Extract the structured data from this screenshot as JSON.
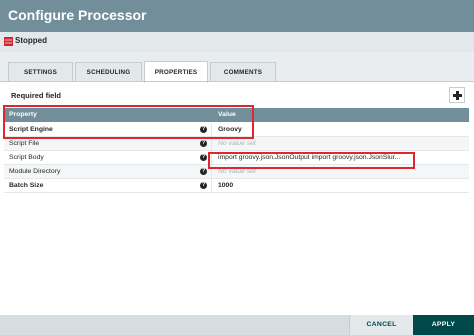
{
  "dialog": {
    "title": "Configure Processor"
  },
  "status": {
    "text": "Stopped",
    "icon": "stopped-icon",
    "color": "#d1252f"
  },
  "tabs": [
    {
      "label": "SETTINGS",
      "active": false
    },
    {
      "label": "SCHEDULING",
      "active": false
    },
    {
      "label": "PROPERTIES",
      "active": true
    },
    {
      "label": "COMMENTS",
      "active": false
    }
  ],
  "properties": {
    "required_label": "Required field",
    "add_icon": "plus-icon",
    "columns": {
      "property": "Property",
      "value": "Value"
    },
    "rows": [
      {
        "name": "Script Engine",
        "value": "Groovy",
        "required": true,
        "value_set": true
      },
      {
        "name": "Script File",
        "value": "No value set",
        "required": false,
        "value_set": false
      },
      {
        "name": "Script Body",
        "value": "import groovy.json.JsonOutput import groovy.json.JsonSlur...",
        "required": false,
        "value_set": true
      },
      {
        "name": "Module Directory",
        "value": "No value set",
        "required": false,
        "value_set": false
      },
      {
        "name": "Batch Size",
        "value": "1000",
        "required": true,
        "value_set": true
      }
    ]
  },
  "footer": {
    "cancel_label": "CANCEL",
    "apply_label": "APPLY"
  },
  "colors": {
    "header": "#728e9b",
    "accent": "#004849",
    "highlight": "#e0262e"
  }
}
